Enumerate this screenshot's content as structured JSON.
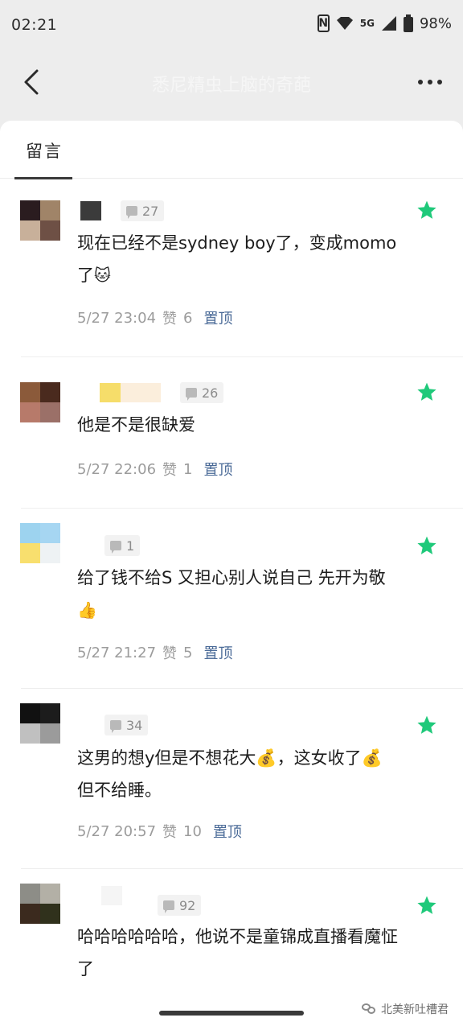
{
  "status_bar": {
    "time": "02:21",
    "network": "5G",
    "battery": "98%"
  },
  "nav": {
    "title": "悉尼精虫上脑的奇葩"
  },
  "tabs": [
    {
      "label": "留言",
      "active": true
    }
  ],
  "comments": [
    {
      "text": "现在已经不是sydney boy了，变成momo了",
      "emoji": "🐱",
      "time": "5/27 23:04",
      "likes_label": "赞",
      "likes": "6",
      "pin_label": "置顶",
      "reply_count": "27",
      "avatar_colors": [
        "#2a1c1f",
        "#a08468",
        "#c8b09a",
        "#6e5045"
      ],
      "name_blur_colors": [
        "#3b3b3b"
      ]
    },
    {
      "text": "他是不是很缺爱",
      "emoji": "",
      "time": "5/27 22:06",
      "likes_label": "赞",
      "likes": "1",
      "pin_label": "置顶",
      "reply_count": "26",
      "avatar_colors": [
        "#8b5a3a",
        "#4a2a1e",
        "#b77a6a",
        "#9b7068"
      ],
      "name_blur_colors": [
        "#f6dd6a",
        "#fbeedc"
      ]
    },
    {
      "text": "给了钱不给S 又担心别人说自己 先开为敬",
      "emoji": "👍",
      "time": "5/27 21:27",
      "likes_label": "赞",
      "likes": "5",
      "pin_label": "置顶",
      "reply_count": "1",
      "avatar_colors": [
        "#9dd3ef",
        "#a6d6f2",
        "#f8df6e",
        "#eef2f4"
      ],
      "name_blur_colors": []
    },
    {
      "text": "这男的想y但是不想花大💰，这女收了💰但不给睡。",
      "emoji": "",
      "time": "5/27 20:57",
      "likes_label": "赞",
      "likes": "10",
      "pin_label": "置顶",
      "reply_count": "34",
      "avatar_colors": [
        "#111111",
        "#1c1c1c",
        "#c0c0c0",
        "#9b9b9b"
      ],
      "name_blur_colors": []
    },
    {
      "text": "哈哈哈哈哈哈，他说不是童锦成直播看魔怔了",
      "emoji": "",
      "time": "",
      "likes_label": "",
      "likes": "",
      "pin_label": "",
      "reply_count": "92",
      "avatar_colors": [
        "#8d8d87",
        "#b3b0a6",
        "#3b2a1e",
        "#30311c"
      ],
      "name_blur_colors": []
    }
  ],
  "watermark": {
    "text": "北美新吐槽君"
  },
  "colors": {
    "star": "#1fc97a",
    "pin_link": "#4a6a97",
    "meta": "#9c9c9c"
  }
}
